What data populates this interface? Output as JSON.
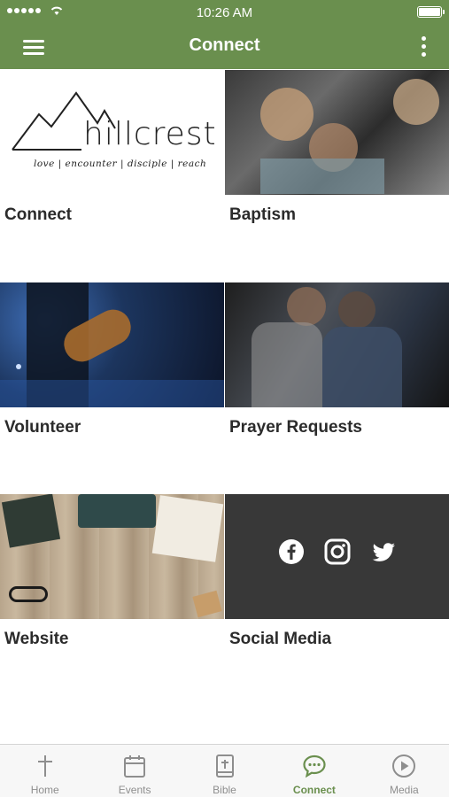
{
  "status_bar": {
    "time": "10:26 AM"
  },
  "nav": {
    "title": "Connect"
  },
  "logo": {
    "word": "hillcrest",
    "tagline": "love | encounter | disciple | reach"
  },
  "tiles": [
    {
      "label": "Connect"
    },
    {
      "label": "Baptism"
    },
    {
      "label": "Volunteer"
    },
    {
      "label": "Prayer Requests"
    },
    {
      "label": "Website"
    },
    {
      "label": "Social Media"
    }
  ],
  "social_icons": [
    "facebook-icon",
    "instagram-icon",
    "twitter-icon"
  ],
  "tab_bar": [
    {
      "label": "Home",
      "icon": "cross-icon"
    },
    {
      "label": "Events",
      "icon": "calendar-icon"
    },
    {
      "label": "Bible",
      "icon": "bible-icon"
    },
    {
      "label": "Connect",
      "icon": "chat-icon",
      "active": true
    },
    {
      "label": "Media",
      "icon": "play-icon"
    }
  ],
  "colors": {
    "accent": "#6a8f4e",
    "tab_inactive": "#8e8e8e",
    "social_bg": "#383838"
  }
}
